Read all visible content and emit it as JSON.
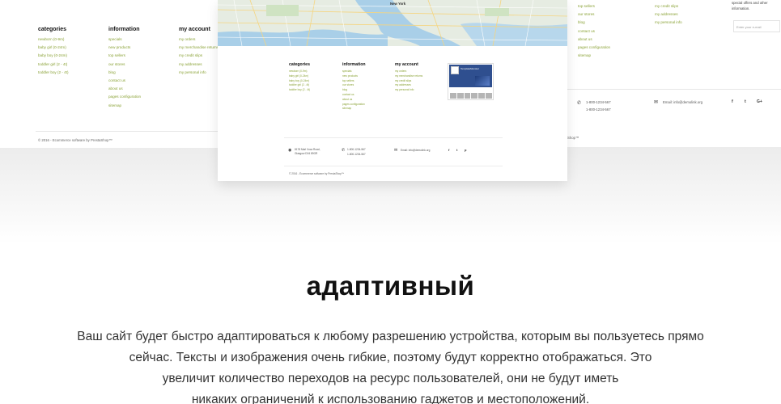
{
  "left_screen": {
    "columns": [
      {
        "title": "categories",
        "items": [
          "newborn (0-9m)",
          "baby girl (0-24m)",
          "baby boy (0-24m)",
          "toddler girl (2 - 4t)",
          "toddler boy (2 - 4t)"
        ]
      },
      {
        "title": "information",
        "items": [
          "specials",
          "new products",
          "top sellers",
          "our stores",
          "blog",
          "contact us",
          "about us",
          "pages configuration",
          "sitemap"
        ]
      },
      {
        "title": "my account",
        "items": [
          "my orders",
          "my merchandise returns",
          "my credit slips",
          "my addresses",
          "my personal info"
        ]
      }
    ],
    "copyright": "© 2016 - Ecommerce software by PrestaShop™"
  },
  "right_screen": {
    "col_a": [
      "top sellers",
      "our stores",
      "blog",
      "contact us",
      "about us",
      "pages configuration",
      "sitemap"
    ],
    "col_b": [
      "my credit slips",
      "my addresses",
      "my personal info"
    ],
    "newsletter_text": "special offers and other information.",
    "newsletter_placeholder": "Enter your e-mail",
    "phone_1": "1-800-1234-567",
    "phone_2": "1-800-1234-567",
    "email": "Email: info@demolink.org",
    "social": [
      "f",
      "t",
      "G+"
    ],
    "shop_suffix": "Shop™"
  },
  "front_screen": {
    "map_label": "New York",
    "columns": [
      {
        "title": "categories",
        "items": [
          "newborn (0-9m)",
          "baby girl (0-24m)",
          "baby boy (0-24m)",
          "toddler girl (2 - 4t)",
          "toddler boy (2 - 4t)"
        ]
      },
      {
        "title": "information",
        "items": [
          "specials",
          "new products",
          "top sellers",
          "our stores",
          "blog",
          "contact us",
          "about us",
          "pages configuration",
          "sitemap"
        ]
      },
      {
        "title": "my account",
        "items": [
          "my orders",
          "my merchandise returns",
          "my credit slips",
          "my addresses",
          "my personal info"
        ]
      }
    ],
    "fb_name": "TemplateMonster",
    "address": "8178 Marl Voca Road, Glasgow D04 89GR",
    "phone_1": "1-800-1234-567",
    "phone_2": "1-800-1234-567",
    "email": "Email: info@demolink.org",
    "social": [
      "f",
      "t",
      "p"
    ],
    "copyright": "© 2016 - Ecommerce software by PrestaShop™"
  },
  "headline": "адаптивный",
  "description_lines": [
    "Ваш сайт будет быстро адаптироваться к любому разрешению устройства, которым вы пользуетесь прямо",
    "сейчас. Тексты и изображения очень гибкие, поэтому будут корректно отображаться. Это",
    "увеличит количество переходов на ресурс пользователей, они не будут иметь",
    "никаких ограничений к использованию гаджетов и местоположений."
  ]
}
